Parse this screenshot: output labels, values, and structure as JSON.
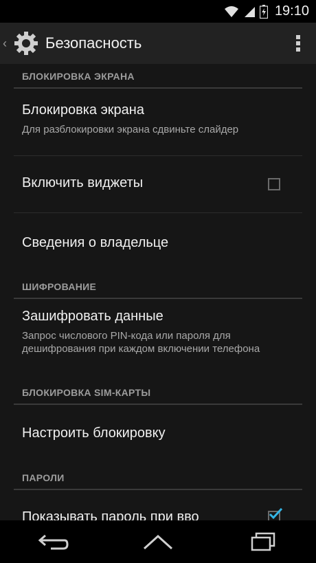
{
  "status_bar": {
    "time": "19:10",
    "icons": [
      "wifi-icon",
      "signal-icon",
      "battery-icon"
    ]
  },
  "action_bar": {
    "title": "Безопасность",
    "back_icon": "chevron-left-icon",
    "app_icon": "gear-icon",
    "overflow_icon": "overflow-menu-icon"
  },
  "sections": [
    {
      "header": "БЛОКИРОВКА ЭКРАНА",
      "items": [
        {
          "title": "Блокировка экрана",
          "summary": "Для разблокировки экрана сдвиньте слайдер"
        },
        {
          "title": "Включить виджеты",
          "checked": false
        },
        {
          "title": "Сведения о владельце"
        }
      ]
    },
    {
      "header": "ШИФРОВАНИЕ",
      "items": [
        {
          "title": "Зашифровать данные",
          "summary": "Запрос числового PIN-кода или пароля для дешифрования при каждом включении телефона"
        }
      ]
    },
    {
      "header": "БЛОКИРОВКА SIM-КАРТЫ",
      "items": [
        {
          "title": "Настроить блокировку"
        }
      ]
    },
    {
      "header": "ПАРОЛИ",
      "items": [
        {
          "title": "Показывать пароль при вво",
          "checked": true
        }
      ]
    }
  ],
  "nav_bar": {
    "buttons": [
      "back-nav-icon",
      "home-nav-icon",
      "recents-nav-icon"
    ]
  },
  "colors": {
    "background": "#161616",
    "action_bar": "#222222",
    "accent": "#33b5e5",
    "section_text": "#9c9c9c"
  }
}
